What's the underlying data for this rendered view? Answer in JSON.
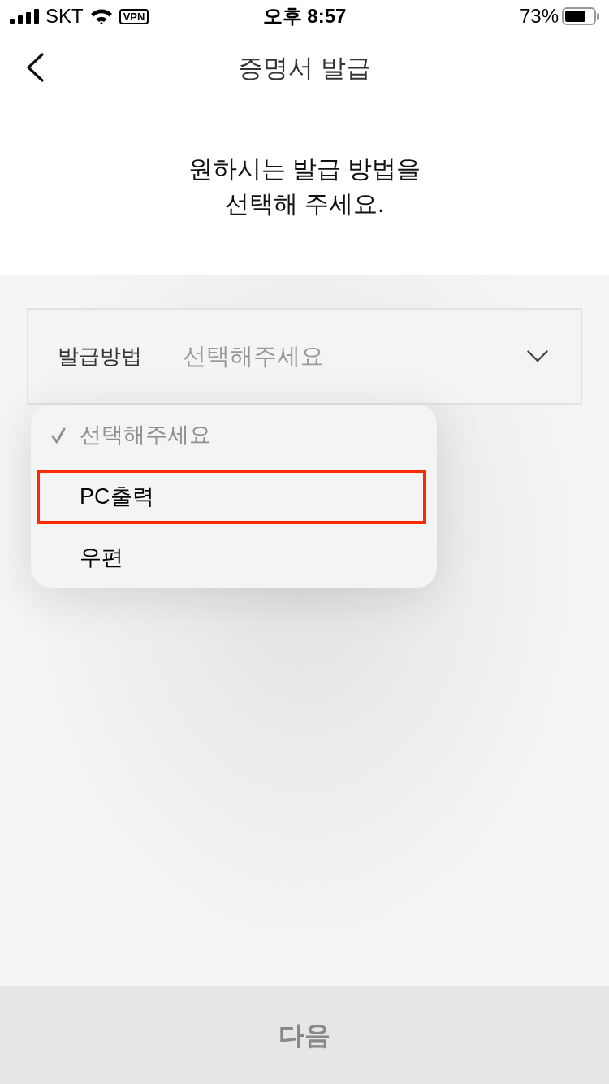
{
  "status_bar": {
    "carrier": "SKT",
    "vpn": "VPN",
    "time": "오후 8:57",
    "battery": "73%"
  },
  "nav": {
    "title": "증명서 발급"
  },
  "prompt": "원하시는 발급 방법을\n선택해 주세요.",
  "field": {
    "label": "발급방법",
    "placeholder": "선택해주세요",
    "expanded": true
  },
  "dropdown": {
    "options": [
      {
        "label": "선택해주세요",
        "selected": true,
        "disabled": true,
        "highlighted": false
      },
      {
        "label": "PC출력",
        "selected": false,
        "disabled": false,
        "highlighted": true
      },
      {
        "label": "우편",
        "selected": false,
        "disabled": false,
        "highlighted": false
      }
    ]
  },
  "next_button": {
    "label": "다음",
    "disabled": true
  }
}
